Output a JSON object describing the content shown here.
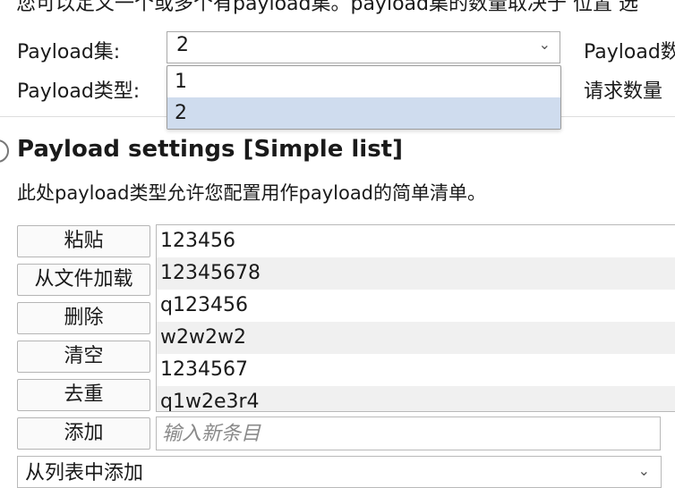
{
  "header_text": "您可以定义一个或多个有payload集。payload集的数量取决于 位置 选",
  "payload_set": {
    "label": "Payload集:",
    "value": "2",
    "chevron_icon": "chevron-down-icon"
  },
  "payload_type": {
    "label": "Payload类型:"
  },
  "right_labels": {
    "count": "Payload数",
    "requests": "请求数量"
  },
  "dropdown": {
    "options": [
      "1",
      "2"
    ],
    "selected": "2",
    "highlight_color": "#cfdcee"
  },
  "settings": {
    "title": "Payload settings [Simple list]",
    "description": "此处payload类型允许您配置用作payload的简单清单。"
  },
  "buttons": {
    "paste": "粘贴",
    "load": "从文件加载",
    "remove": "删除",
    "clear": "清空",
    "dedupe": "去重",
    "add": "添加"
  },
  "list_items": [
    "123456",
    "12345678",
    "q123456",
    "w2w2w2",
    "1234567",
    "q1w2e3r4"
  ],
  "new_item": {
    "placeholder": "输入新条目"
  },
  "add_from_list": {
    "value": "从列表中添加"
  }
}
